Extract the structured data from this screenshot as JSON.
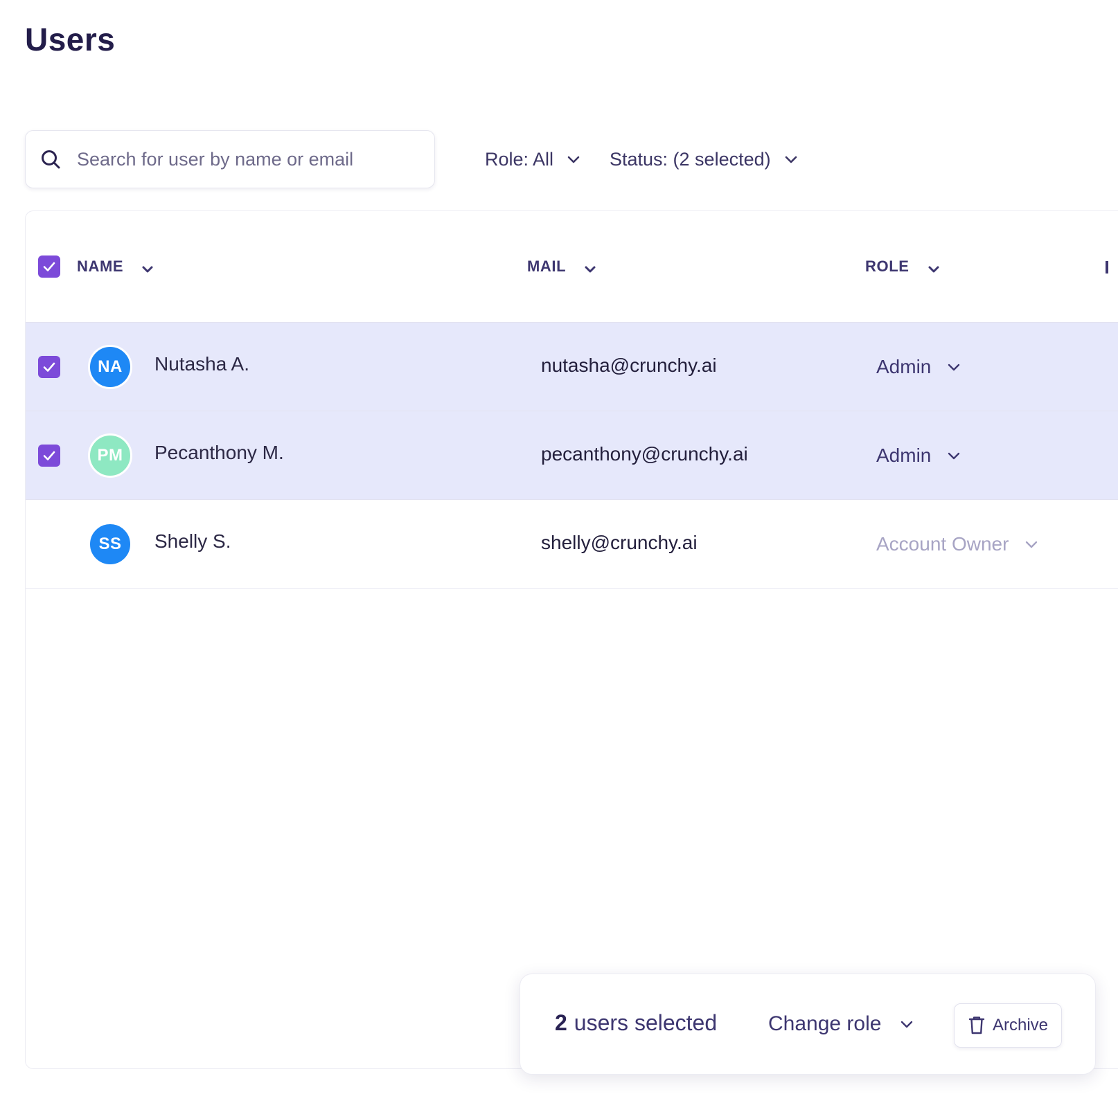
{
  "page": {
    "title": "Users"
  },
  "toolbar": {
    "search_placeholder": "Search for user by name or email",
    "search_value": "",
    "role_filter": "Role: All",
    "status_filter": "Status: (2 selected)"
  },
  "table": {
    "columns": [
      "NAME",
      "MAIL",
      "ROLE"
    ],
    "header_checkbox_checked": true,
    "rows": [
      {
        "checked": true,
        "initials": "NA",
        "avatar_color": "#1e88f5",
        "name": "Nutasha A.",
        "mail": "nutasha@crunchy.ai",
        "role": "Admin",
        "role_muted": false
      },
      {
        "checked": true,
        "initials": "PM",
        "avatar_color": "#8ee8c2",
        "name": "Pecanthony M.",
        "mail": "pecanthony@crunchy.ai",
        "role": "Admin",
        "role_muted": false
      },
      {
        "checked": false,
        "initials": "SS",
        "avatar_color": "#1e88f5",
        "name": "Shelly S.",
        "mail": "shelly@crunchy.ai",
        "role": "Account Owner",
        "role_muted": true
      }
    ]
  },
  "bulk_bar": {
    "count": "2",
    "count_suffix": "users selected",
    "change_role_label": "Change role",
    "archive_label": "Archive"
  },
  "colors": {
    "accent": "#7c4ad9",
    "selected_row": "#e6e8fb",
    "text_dark": "#231d4a"
  },
  "icons": {
    "search": "search-icon",
    "dropdown": "chevron-down-icon",
    "checkbox": "checkmark-icon",
    "archive": "trash-icon"
  }
}
